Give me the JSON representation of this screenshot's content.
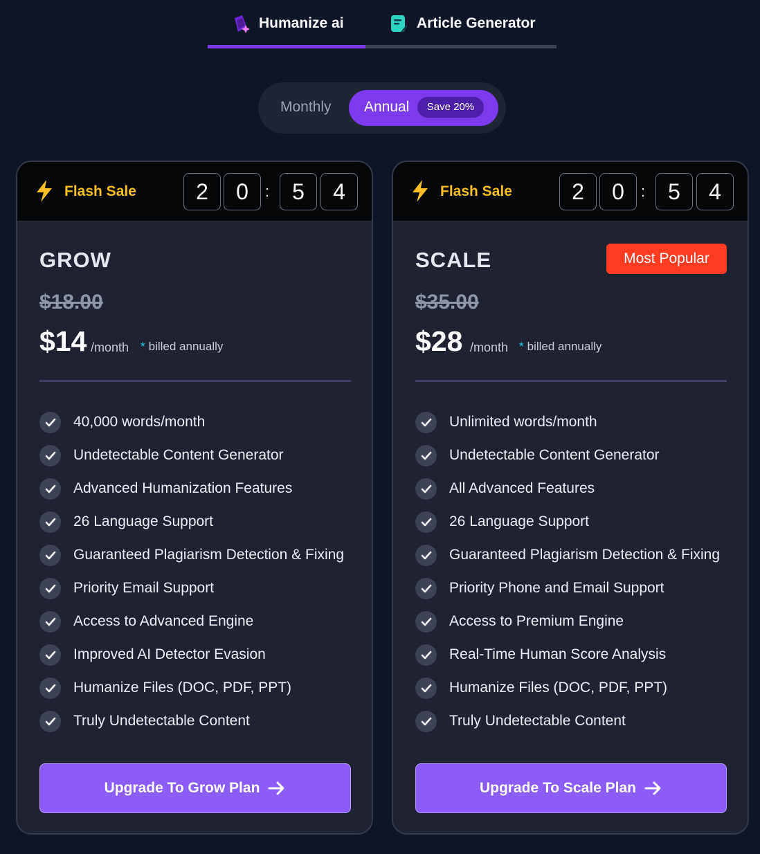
{
  "tabs": [
    {
      "label": "Humanize ai",
      "icon": "humanize-sparkle-icon",
      "active": true
    },
    {
      "label": "Article Generator",
      "icon": "article-document-icon",
      "active": false
    }
  ],
  "billing_toggle": {
    "monthly_label": "Monthly",
    "annual_label": "Annual",
    "save_badge": "Save 20%",
    "selected": "Annual"
  },
  "colors": {
    "accent": "#7c3aed",
    "cta": "#8b5cf6",
    "flash": "#fbbf24",
    "popular": "#ff3b24",
    "background": "#0f1628",
    "card": "#1f2231"
  },
  "plans": [
    {
      "flash_label": "Flash Sale",
      "timer": {
        "d1": "2",
        "d2": "0",
        "sep": ":",
        "d3": "5",
        "d4": "4"
      },
      "name": "GROW",
      "old_price": "$18.00",
      "price": "$14",
      "per": "/month",
      "billed_star": "*",
      "billed": "billed annually",
      "features": [
        "40,000 words/month",
        "Undetectable Content Generator",
        "Advanced Humanization Features",
        "26 Language Support",
        "Guaranteed Plagiarism Detection & Fixing",
        "Priority Email Support",
        "Access to Advanced Engine",
        "Improved AI Detector Evasion",
        "Humanize Files (DOC, PDF, PPT)",
        "Truly Undetectable Content"
      ],
      "cta": "Upgrade To Grow Plan"
    },
    {
      "flash_label": "Flash Sale",
      "timer": {
        "d1": "2",
        "d2": "0",
        "sep": ":",
        "d3": "5",
        "d4": "4"
      },
      "name": "SCALE",
      "badge": "Most Popular",
      "old_price": "$35.00",
      "price": "$28",
      "per": "/month",
      "billed_star": "*",
      "billed": "billed annually",
      "features": [
        "Unlimited words/month",
        "Undetectable Content Generator",
        "All Advanced Features",
        "26 Language Support",
        "Guaranteed Plagiarism Detection & Fixing",
        "Priority Phone and Email Support",
        "Access to Premium Engine",
        "Real-Time Human Score Analysis",
        "Humanize Files (DOC, PDF, PPT)",
        "Truly Undetectable Content"
      ],
      "cta": "Upgrade To Scale Plan"
    }
  ]
}
